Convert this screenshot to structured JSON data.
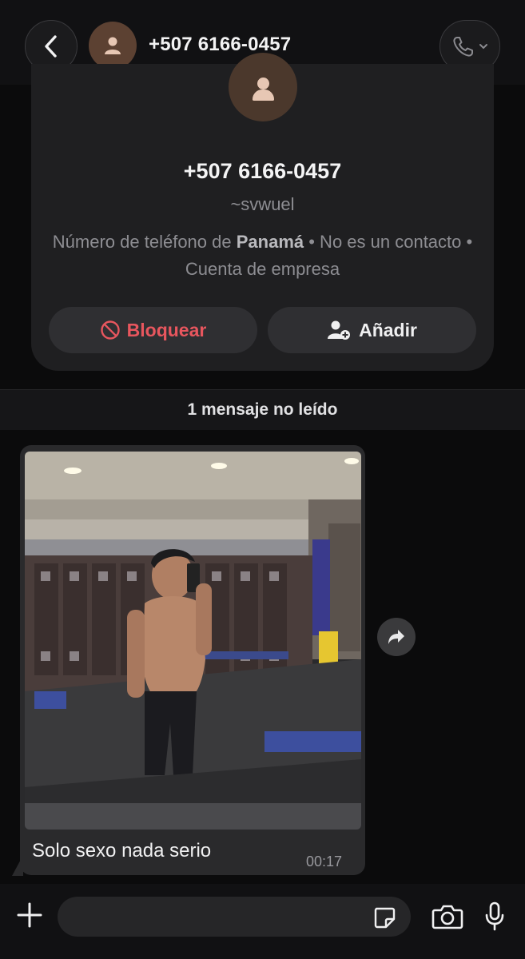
{
  "header": {
    "title": "+507 6166-0457",
    "back_icon": "chevron-left-icon",
    "avatar_icon": "person-icon",
    "call_icon": "phone-icon"
  },
  "info_card": {
    "name": "+507 6166-0457",
    "alias": "~svwuel",
    "description_prefix": "Número de teléfono de ",
    "country": "Panamá",
    "description_suffix": " • No es un contacto • Cuenta de empresa",
    "block_label": "Bloquear",
    "add_label": "Añadir"
  },
  "unread_label": "1 mensaje no leído",
  "message": {
    "caption": "Solo sexo nada serio",
    "time": "00:17"
  },
  "input": {
    "placeholder": ""
  },
  "colors": {
    "background": "#0b0b0c",
    "card": "#1f1f21",
    "bubble": "#2a2a2c",
    "danger": "#e8565e",
    "avatar": "#5c4132"
  }
}
